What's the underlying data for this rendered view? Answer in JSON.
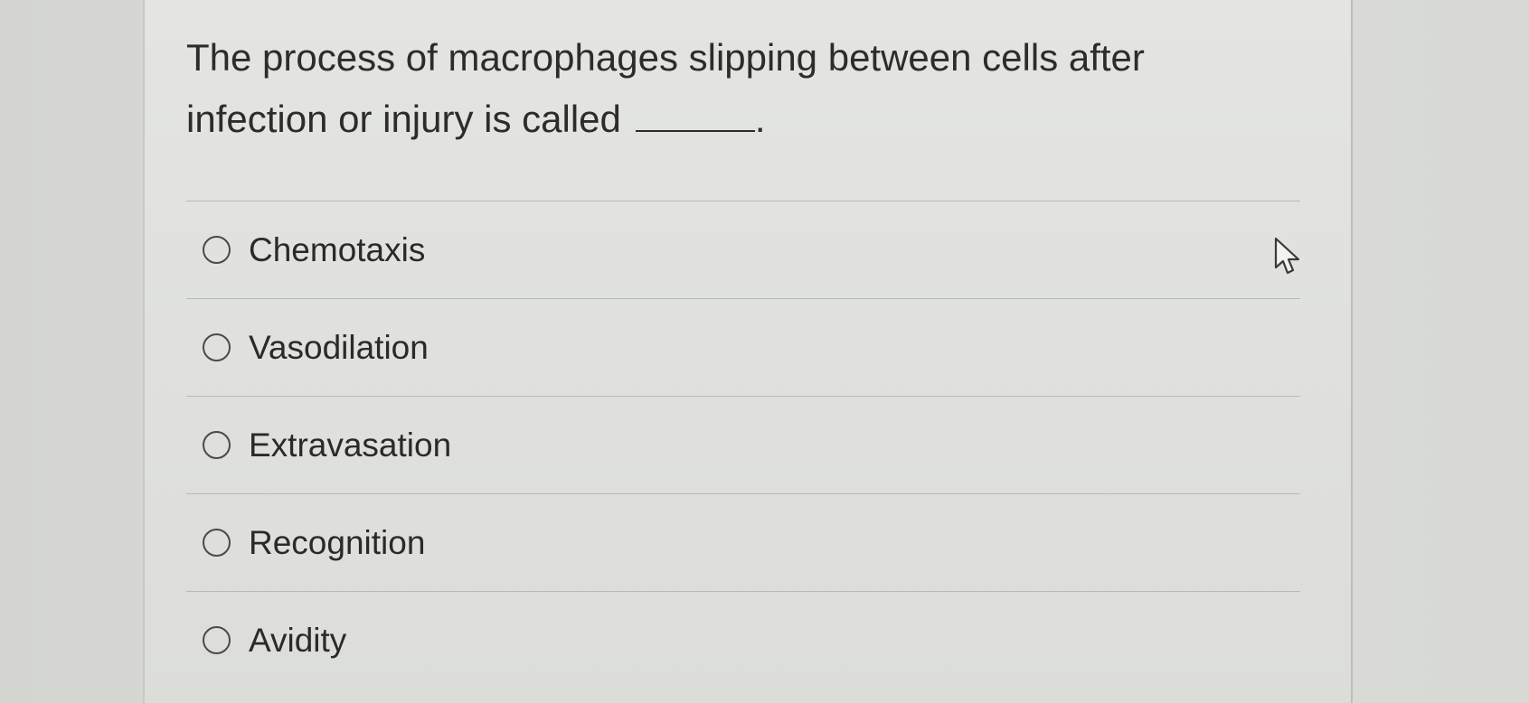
{
  "question": {
    "text": "The process of macrophages slipping between cells after infection or injury is called",
    "end_punctuation": "."
  },
  "options": [
    {
      "label": "Chemotaxis",
      "selected": false
    },
    {
      "label": "Vasodilation",
      "selected": false
    },
    {
      "label": "Extravasation",
      "selected": false
    },
    {
      "label": "Recognition",
      "selected": false
    },
    {
      "label": "Avidity",
      "selected": false
    }
  ],
  "cursor": {
    "icon": "pointer-cursor-icon"
  }
}
